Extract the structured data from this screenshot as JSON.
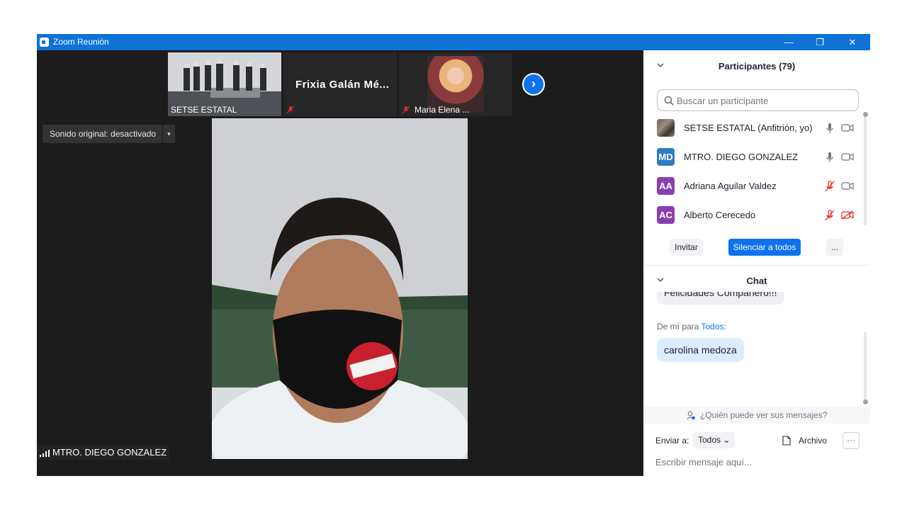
{
  "window": {
    "title": "Zoom Reunión",
    "min": "—",
    "max": "❐",
    "close": "✕"
  },
  "thumbnails": [
    {
      "name": "SETSE ESTATAL"
    },
    {
      "name": "Frixia Galán Mé..."
    },
    {
      "name": "Maria Elena ..."
    }
  ],
  "next_icon": "chevron-right-icon",
  "original_sound": {
    "label": "Sonido original: desactivado",
    "caret": "▾"
  },
  "main_video": {
    "speaker": "MTRO. DIEGO GONZALEZ"
  },
  "participants": {
    "title": "Participantes (79)",
    "search_placeholder": "Buscar un participante",
    "list": [
      {
        "initials": "",
        "name": "SETSE ESTATAL (Anfitrión, yo)",
        "color": "#7a6e60",
        "muted": false,
        "video_off": false
      },
      {
        "initials": "MD",
        "name": "MTRO. DIEGO GONZALEZ",
        "color": "#2f7dc1",
        "muted": false,
        "video_off": false
      },
      {
        "initials": "AA",
        "name": "Adriana Aguilar Valdez",
        "color": "#8a3fb0",
        "muted": true,
        "video_off": false
      },
      {
        "initials": "AC",
        "name": "Alberto Cerecedo",
        "color": "#8a3fb0",
        "muted": true,
        "video_off": true
      }
    ],
    "invite_label": "Invitar",
    "mute_all_label": "Silenciar a todos",
    "more_label": "..."
  },
  "chat": {
    "title": "Chat",
    "messages": [
      {
        "text": "Felicidades Compañero!!!"
      },
      {
        "text": "carolina medoza"
      }
    ],
    "from_prefix": "De mí para",
    "from_to": "Todos",
    "from_colon": ":",
    "who_sees": "¿Quién puede ver sus mensajes?",
    "send_to_label": "Enviar a:",
    "recipient": "Todos",
    "recipient_caret": "⌄",
    "file_label": "Archivo",
    "more_label": "···",
    "input_placeholder": "Escribir mensaje aquí..."
  },
  "colors": {
    "accent": "#0e72ed",
    "titlebar": "#0e72d6",
    "muted_red": "#e02828"
  }
}
